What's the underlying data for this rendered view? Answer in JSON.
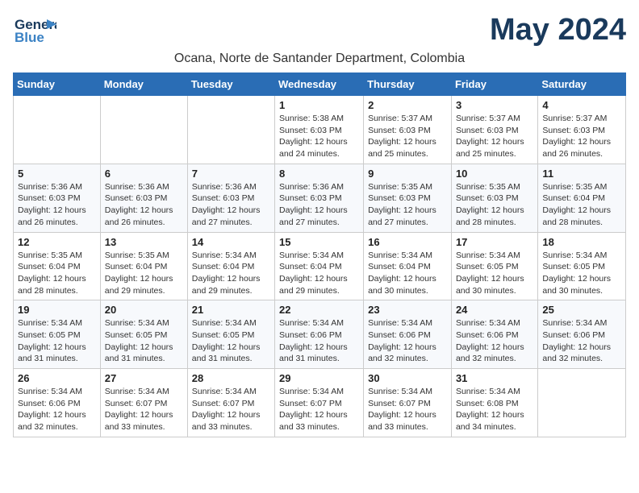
{
  "header": {
    "logo_line1": "General",
    "logo_line2": "Blue",
    "month": "May 2024",
    "location": "Ocana, Norte de Santander Department, Colombia"
  },
  "days_of_week": [
    "Sunday",
    "Monday",
    "Tuesday",
    "Wednesday",
    "Thursday",
    "Friday",
    "Saturday"
  ],
  "weeks": [
    {
      "cells": [
        {
          "day": "",
          "info": ""
        },
        {
          "day": "",
          "info": ""
        },
        {
          "day": "",
          "info": ""
        },
        {
          "day": "1",
          "info": "Sunrise: 5:38 AM\nSunset: 6:03 PM\nDaylight: 12 hours\nand 24 minutes."
        },
        {
          "day": "2",
          "info": "Sunrise: 5:37 AM\nSunset: 6:03 PM\nDaylight: 12 hours\nand 25 minutes."
        },
        {
          "day": "3",
          "info": "Sunrise: 5:37 AM\nSunset: 6:03 PM\nDaylight: 12 hours\nand 25 minutes."
        },
        {
          "day": "4",
          "info": "Sunrise: 5:37 AM\nSunset: 6:03 PM\nDaylight: 12 hours\nand 26 minutes."
        }
      ]
    },
    {
      "cells": [
        {
          "day": "5",
          "info": "Sunrise: 5:36 AM\nSunset: 6:03 PM\nDaylight: 12 hours\nand 26 minutes."
        },
        {
          "day": "6",
          "info": "Sunrise: 5:36 AM\nSunset: 6:03 PM\nDaylight: 12 hours\nand 26 minutes."
        },
        {
          "day": "7",
          "info": "Sunrise: 5:36 AM\nSunset: 6:03 PM\nDaylight: 12 hours\nand 27 minutes."
        },
        {
          "day": "8",
          "info": "Sunrise: 5:36 AM\nSunset: 6:03 PM\nDaylight: 12 hours\nand 27 minutes."
        },
        {
          "day": "9",
          "info": "Sunrise: 5:35 AM\nSunset: 6:03 PM\nDaylight: 12 hours\nand 27 minutes."
        },
        {
          "day": "10",
          "info": "Sunrise: 5:35 AM\nSunset: 6:03 PM\nDaylight: 12 hours\nand 28 minutes."
        },
        {
          "day": "11",
          "info": "Sunrise: 5:35 AM\nSunset: 6:04 PM\nDaylight: 12 hours\nand 28 minutes."
        }
      ]
    },
    {
      "cells": [
        {
          "day": "12",
          "info": "Sunrise: 5:35 AM\nSunset: 6:04 PM\nDaylight: 12 hours\nand 28 minutes."
        },
        {
          "day": "13",
          "info": "Sunrise: 5:35 AM\nSunset: 6:04 PM\nDaylight: 12 hours\nand 29 minutes."
        },
        {
          "day": "14",
          "info": "Sunrise: 5:34 AM\nSunset: 6:04 PM\nDaylight: 12 hours\nand 29 minutes."
        },
        {
          "day": "15",
          "info": "Sunrise: 5:34 AM\nSunset: 6:04 PM\nDaylight: 12 hours\nand 29 minutes."
        },
        {
          "day": "16",
          "info": "Sunrise: 5:34 AM\nSunset: 6:04 PM\nDaylight: 12 hours\nand 30 minutes."
        },
        {
          "day": "17",
          "info": "Sunrise: 5:34 AM\nSunset: 6:05 PM\nDaylight: 12 hours\nand 30 minutes."
        },
        {
          "day": "18",
          "info": "Sunrise: 5:34 AM\nSunset: 6:05 PM\nDaylight: 12 hours\nand 30 minutes."
        }
      ]
    },
    {
      "cells": [
        {
          "day": "19",
          "info": "Sunrise: 5:34 AM\nSunset: 6:05 PM\nDaylight: 12 hours\nand 31 minutes."
        },
        {
          "day": "20",
          "info": "Sunrise: 5:34 AM\nSunset: 6:05 PM\nDaylight: 12 hours\nand 31 minutes."
        },
        {
          "day": "21",
          "info": "Sunrise: 5:34 AM\nSunset: 6:05 PM\nDaylight: 12 hours\nand 31 minutes."
        },
        {
          "day": "22",
          "info": "Sunrise: 5:34 AM\nSunset: 6:06 PM\nDaylight: 12 hours\nand 31 minutes."
        },
        {
          "day": "23",
          "info": "Sunrise: 5:34 AM\nSunset: 6:06 PM\nDaylight: 12 hours\nand 32 minutes."
        },
        {
          "day": "24",
          "info": "Sunrise: 5:34 AM\nSunset: 6:06 PM\nDaylight: 12 hours\nand 32 minutes."
        },
        {
          "day": "25",
          "info": "Sunrise: 5:34 AM\nSunset: 6:06 PM\nDaylight: 12 hours\nand 32 minutes."
        }
      ]
    },
    {
      "cells": [
        {
          "day": "26",
          "info": "Sunrise: 5:34 AM\nSunset: 6:06 PM\nDaylight: 12 hours\nand 32 minutes."
        },
        {
          "day": "27",
          "info": "Sunrise: 5:34 AM\nSunset: 6:07 PM\nDaylight: 12 hours\nand 33 minutes."
        },
        {
          "day": "28",
          "info": "Sunrise: 5:34 AM\nSunset: 6:07 PM\nDaylight: 12 hours\nand 33 minutes."
        },
        {
          "day": "29",
          "info": "Sunrise: 5:34 AM\nSunset: 6:07 PM\nDaylight: 12 hours\nand 33 minutes."
        },
        {
          "day": "30",
          "info": "Sunrise: 5:34 AM\nSunset: 6:07 PM\nDaylight: 12 hours\nand 33 minutes."
        },
        {
          "day": "31",
          "info": "Sunrise: 5:34 AM\nSunset: 6:08 PM\nDaylight: 12 hours\nand 34 minutes."
        },
        {
          "day": "",
          "info": ""
        }
      ]
    }
  ]
}
